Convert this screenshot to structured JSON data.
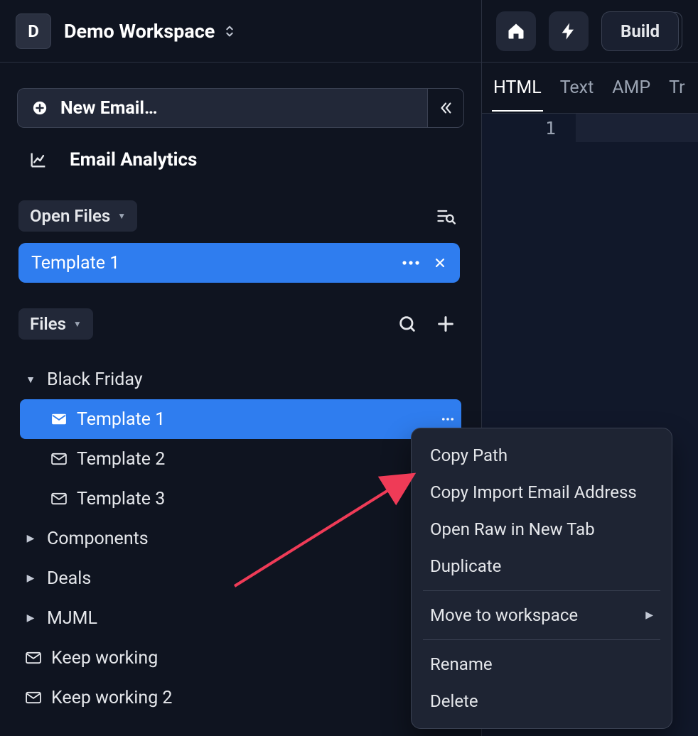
{
  "workspace": {
    "initial": "D",
    "name": "Demo Workspace"
  },
  "toolbar": {
    "build_label": "Build"
  },
  "sidebar": {
    "new_email_label": "New Email…",
    "analytics_label": "Email Analytics",
    "open_files_label": "Open Files",
    "files_label": "Files",
    "open_file": "Template 1",
    "tree": {
      "folder_black_friday": "Black Friday",
      "template1": "Template 1",
      "template2": "Template 2",
      "template3": "Template 3",
      "components": "Components",
      "deals": "Deals",
      "mjml": "MJML",
      "keep_working": "Keep working",
      "keep_working_2": "Keep working 2"
    }
  },
  "editor_tabs": {
    "html": "HTML",
    "text": "Text",
    "amp": "AMP",
    "translate": "Tr"
  },
  "editor": {
    "line1": "1"
  },
  "context_menu": {
    "copy_path": "Copy Path",
    "copy_import": "Copy Import Email Address",
    "open_raw": "Open Raw in New Tab",
    "duplicate": "Duplicate",
    "move_workspace": "Move to workspace",
    "rename": "Rename",
    "delete": "Delete"
  },
  "colors": {
    "accent": "#2f7def",
    "arrow": "#ef3b57"
  }
}
